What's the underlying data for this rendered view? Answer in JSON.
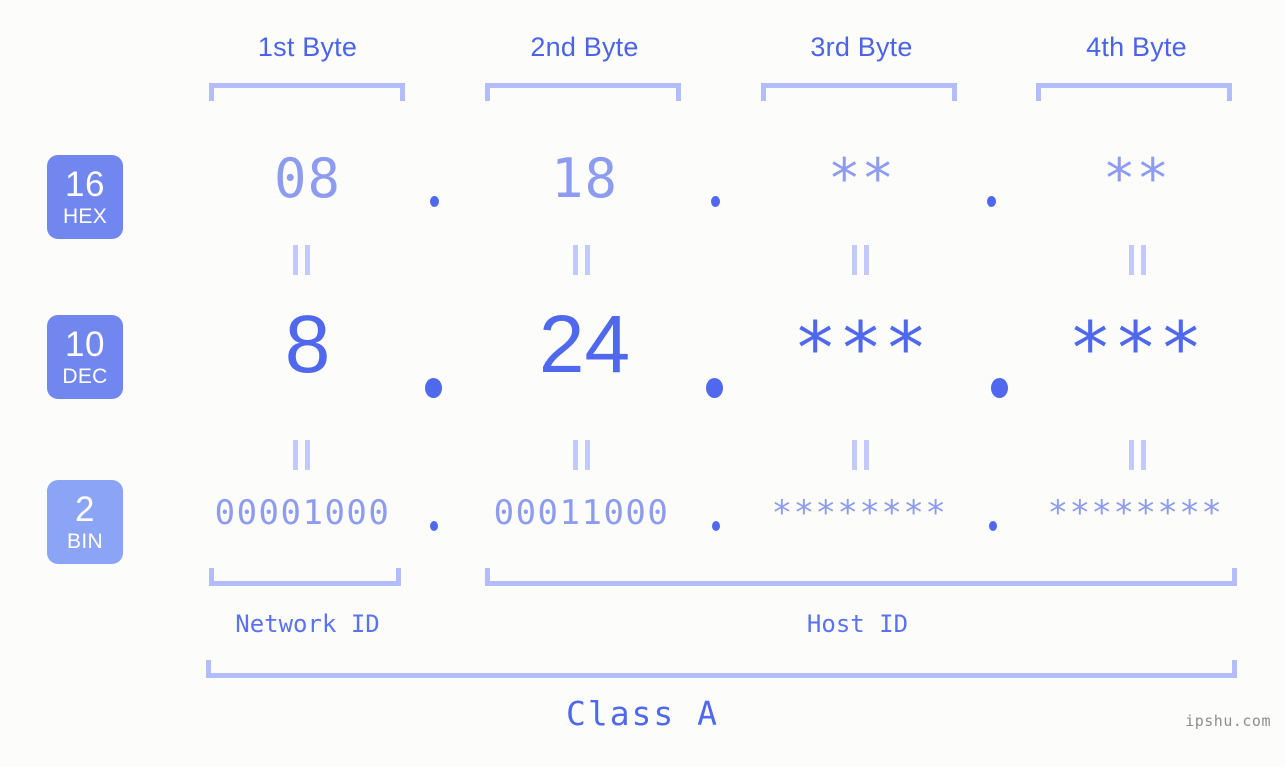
{
  "background_color": "#fcfdfa",
  "accent_color": "#4f68ee",
  "accent_light_color": "#8e9cf0",
  "bracket_color": "#b3bdfb",
  "header": {
    "bytes": [
      {
        "label": "1st Byte"
      },
      {
        "label": "2nd Byte"
      },
      {
        "label": "3rd Byte"
      },
      {
        "label": "4th Byte"
      }
    ]
  },
  "rows": [
    {
      "base": "16",
      "abbr": "HEX",
      "badge_color": "#7186ef",
      "values": [
        "08",
        "18",
        "**",
        "**"
      ],
      "separators": [
        ".",
        ".",
        "."
      ]
    },
    {
      "base": "10",
      "abbr": "DEC",
      "badge_color": "#7186ef",
      "values": [
        "8",
        "24",
        "***",
        "***"
      ],
      "separators": [
        ".",
        ".",
        "."
      ]
    },
    {
      "base": "2",
      "abbr": "BIN",
      "badge_color": "#8ca4f5",
      "values": [
        "00001000",
        "00011000",
        "********",
        "********"
      ],
      "separators": [
        ".",
        ".",
        "."
      ]
    }
  ],
  "equals_separator": "=",
  "id_labels": [
    {
      "text": "Network ID"
    },
    {
      "text": "Host ID"
    }
  ],
  "class_label": "Class A",
  "watermark": "ipshu.com"
}
